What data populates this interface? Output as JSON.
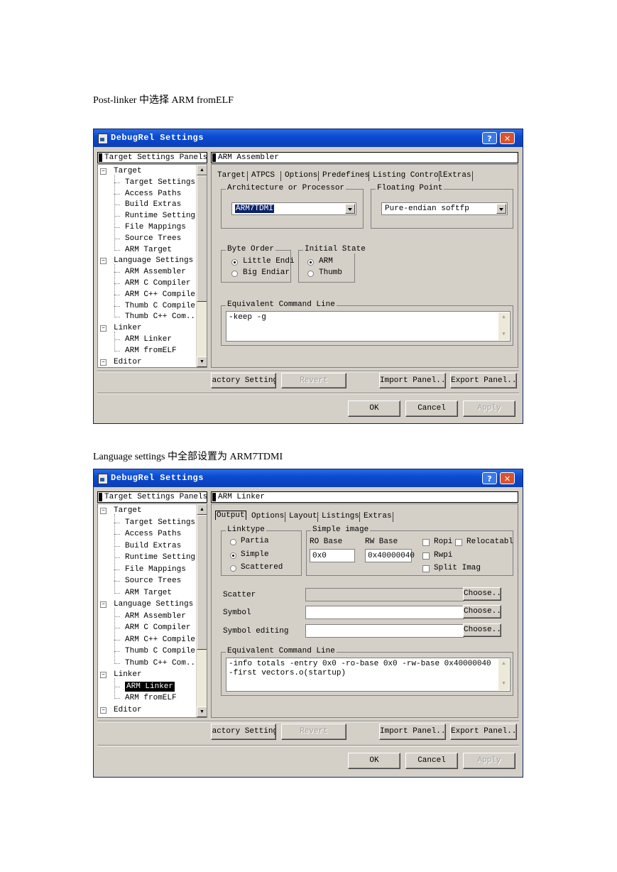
{
  "captions": {
    "first": "Post-linker 中选择 ARM fromELF",
    "second": "Language settings  中全部设置为 ARM7TDMI"
  },
  "dialog1": {
    "title": "DebugRel Settings",
    "help": "?",
    "close": "✕",
    "tree_header": "Target Settings Panels",
    "tree": [
      {
        "label": "Target",
        "level": 0,
        "expander": "−"
      },
      {
        "label": "Target Settings",
        "level": 1
      },
      {
        "label": "Access Paths",
        "level": 1
      },
      {
        "label": "Build Extras",
        "level": 1
      },
      {
        "label": "Runtime Settings",
        "level": 1
      },
      {
        "label": "File Mappings",
        "level": 1
      },
      {
        "label": "Source Trees",
        "level": 1
      },
      {
        "label": "ARM Target",
        "level": 1
      },
      {
        "label": "Language Settings",
        "level": 0,
        "expander": "−"
      },
      {
        "label": "ARM Assembler",
        "level": 1
      },
      {
        "label": "ARM C Compiler",
        "level": 1
      },
      {
        "label": "ARM C++ Compiler",
        "level": 1
      },
      {
        "label": "Thumb C Compiler",
        "level": 1
      },
      {
        "label": "Thumb C++ Com...",
        "level": 1
      },
      {
        "label": "Linker",
        "level": 0,
        "expander": "−"
      },
      {
        "label": "ARM Linker",
        "level": 1
      },
      {
        "label": "ARM fromELF",
        "level": 1
      },
      {
        "label": "Editor",
        "level": 0,
        "expander": "−"
      }
    ],
    "panel_header": "ARM Assembler",
    "tabs": [
      "Target",
      "ATPCS",
      "Options",
      "Predefines",
      "Listing Control",
      "Extras"
    ],
    "arch_group": "Architecture or Processor",
    "arch_value": "ARM7TDMI",
    "fp_group": "Floating Point",
    "fp_value": "Pure-endian softfp",
    "byte_order_group": "Byte Order",
    "byte_order_options": [
      "Little Endi",
      "Big Endiar"
    ],
    "initial_state_group": "Initial State",
    "initial_state_options": [
      "ARM",
      "Thumb"
    ],
    "cmd_group": "Equivalent Command Line",
    "cmd_value": "-keep -g",
    "buttons": {
      "factory": "Factory Settings",
      "revert": "Revert",
      "import": "Import Panel...",
      "export": "Export Panel...",
      "ok": "OK",
      "cancel": "Cancel",
      "apply": "Apply"
    }
  },
  "dialog2": {
    "title": "DebugRel Settings",
    "help": "?",
    "close": "✕",
    "tree_header": "Target Settings Panels",
    "selected_item": "ARM Linker",
    "panel_header": "ARM Linker",
    "tabs": [
      "Output",
      "Options",
      "Layout",
      "Listings",
      "Extras"
    ],
    "linktype_group": "Linktype",
    "linktype_options": [
      "Partia",
      "Simple",
      "Scattered"
    ],
    "simple_group": "Simple image",
    "ro_base_label": "RO Base",
    "ro_base_value": "0x0",
    "rw_base_label": "RW Base",
    "rw_base_value": "0x40000040",
    "checks": [
      "Ropi",
      "Relocatabl",
      "Rwpi",
      "Split Imag"
    ],
    "scatter_label": "Scatter",
    "symbol_label": "Symbol",
    "symbol_editing_label": "Symbol editing",
    "choose": "Choose...",
    "cmd_group": "Equivalent Command Line",
    "cmd_value": "-info totals -entry 0x0 -ro-base 0x0 -rw-base 0x40000040 -first vectors.o(startup)"
  }
}
